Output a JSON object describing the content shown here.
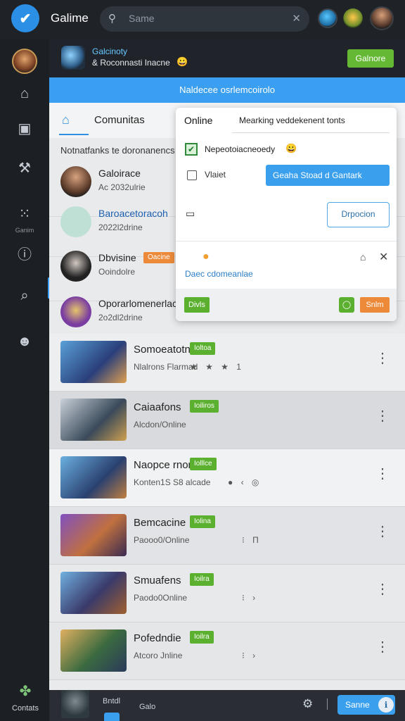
{
  "app": {
    "title": "Galime"
  },
  "search": {
    "placeholder": "Same"
  },
  "header": {
    "name": "Galcinoty",
    "sub": "& Roconnasti Inacne",
    "button": "Galnore"
  },
  "banner": {
    "text": "Naldecee osrlemcoirolo"
  },
  "tabs": {
    "label": "Comunitas"
  },
  "section": {
    "title": "Notnatfanks  te doronanencs"
  },
  "rail": {
    "label": "Ganim",
    "bottom_label": "Contats"
  },
  "friends": [
    {
      "name": "Galoirace",
      "sub": "Ac 2032ulrie"
    },
    {
      "name": "Baroacetoracoh",
      "sub": "2022l2drine"
    },
    {
      "name": "Dbvisine",
      "tag": "Oacine",
      "sub": "Ooindolre"
    },
    {
      "name": "Oporarlomenerlacec",
      "sub": "2o2dl2drine"
    }
  ],
  "games": [
    {
      "name": "Somoeatotn",
      "tag": "Ioltoa",
      "sub": "Nlalrons Flarmad",
      "stat": "★ ★ ★ 1"
    },
    {
      "name": "Caiaafons",
      "tag": "Ioiliros",
      "sub": "Alcdon/Online",
      "stat": ""
    },
    {
      "name": "Naopce rnone",
      "tag": "Iolllce",
      "sub": "Konten1S  S8 alcade",
      "stat": "● ‹ ◎"
    },
    {
      "name": "Bemcacine",
      "tag": "Iolina",
      "sub": "Paooo0/Online",
      "stat": "⁝ Π"
    },
    {
      "name": "Smuafens",
      "tag": "Ioilra",
      "sub": "Paodo0Online",
      "stat": "⁝ ›"
    },
    {
      "name": "Pofedndie",
      "tag": "Ioilra",
      "sub": "Atcoro Jnline",
      "stat": "⁝ ›"
    }
  ],
  "popup": {
    "title": "Online",
    "field": "Mearking veddekenent tonts",
    "check_label": "Nepeotoiacneoedy",
    "box_label": "Vlaiet",
    "blue_button": "Geaha Stoad d Gantark",
    "outline_button": "Drpocion",
    "link": "Daec cdomeanlae",
    "green_button": "Divls",
    "small_button": "Snlm"
  },
  "bottom": {
    "name": "Bntdl",
    "label": "Galo",
    "button": "Sanne"
  }
}
